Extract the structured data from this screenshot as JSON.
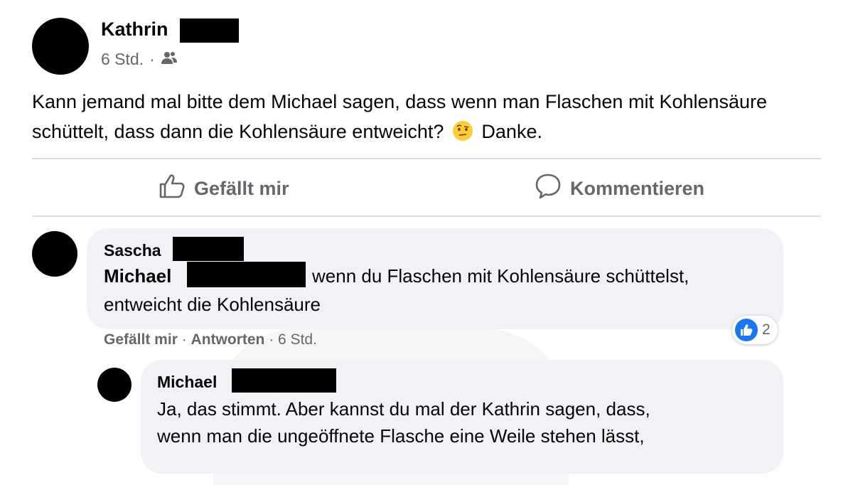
{
  "post": {
    "author": "Kathrin",
    "timestamp": "6 Std.",
    "separator": "·",
    "audience_icon": "friends-icon",
    "text_before_emoji": "Kann jemand mal bitte dem Michael sagen, dass wenn man Flaschen mit Kohlensäure schüttelt, dass dann die Kohlensäure entweicht?",
    "emoji": "face-with-raised-eyebrow-emoji",
    "text_after_emoji": "Danke."
  },
  "actions": {
    "like_label": "Gefällt mir",
    "comment_label": "Kommentieren",
    "like_icon": "thumbs-up-icon",
    "comment_icon": "comment-icon"
  },
  "comments": [
    {
      "author": "Sascha",
      "mention": "Michael",
      "text_line1": "wenn du Flaschen mit Kohlensäure schüttelst,",
      "text_line2": "entweicht die Kohlensäure",
      "like_label": "Gefällt mir",
      "reply_label": "Antworten",
      "timestamp": "6 Std.",
      "reaction_count": "2"
    },
    {
      "author": "Michael",
      "text_line1": "Ja, das stimmt. Aber kannst du mal der Kathrin sagen, dass,",
      "text_line2": "wenn man die ungeöffnete Flasche eine Weile stehen lässt,"
    }
  ],
  "colors": {
    "secondary_text": "#65676b",
    "bubble_bg": "#f0f2f5",
    "like_blue": "#1877f2",
    "divider": "#dadde1"
  }
}
